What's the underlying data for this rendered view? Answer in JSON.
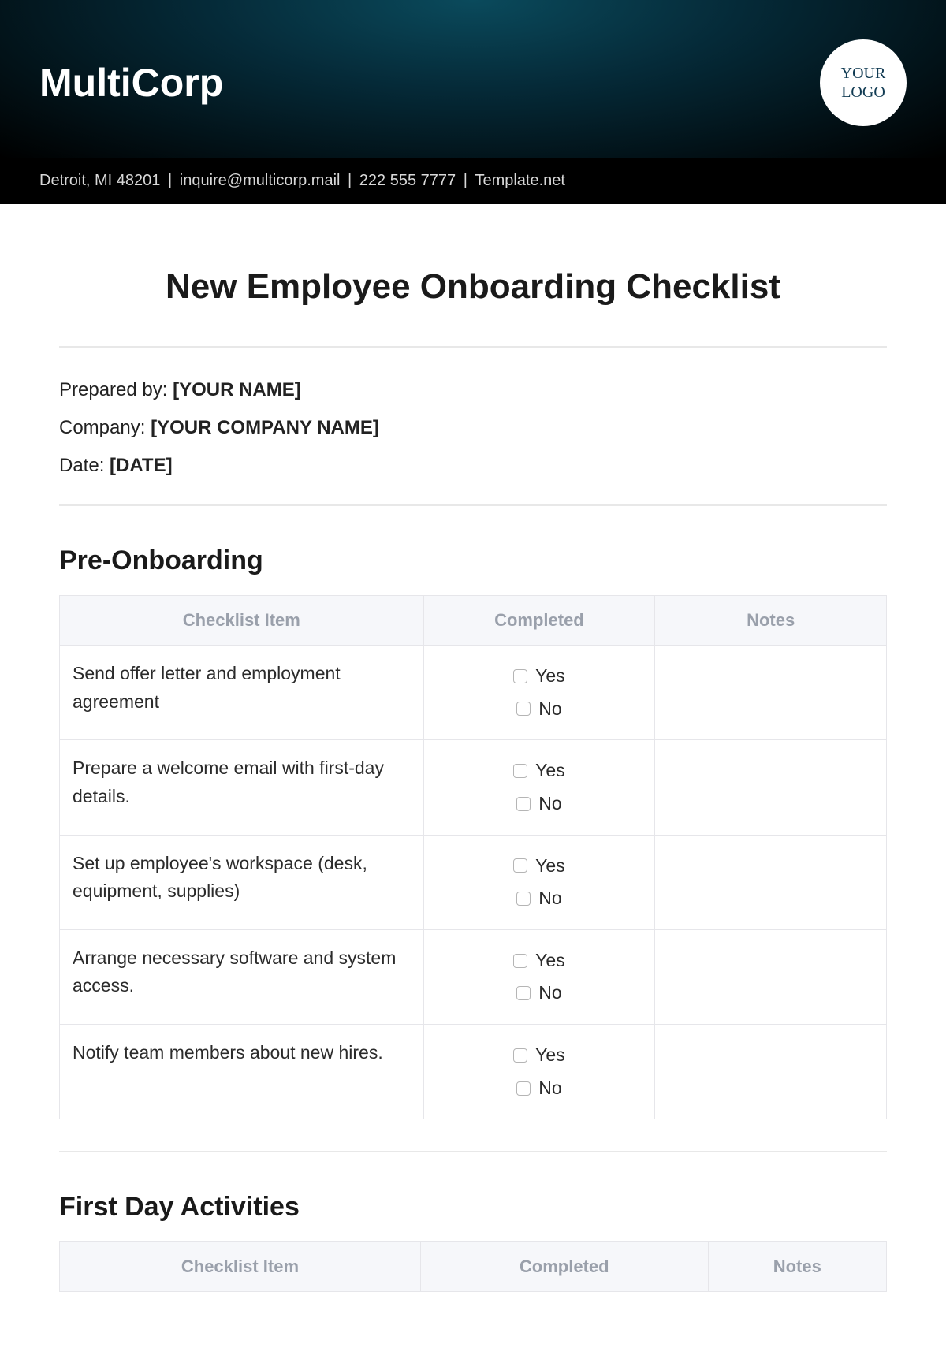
{
  "header": {
    "company_name": "MultiCorp",
    "logo_text": "YOUR\nLOGO"
  },
  "contact": {
    "address": "Detroit, MI 48201",
    "email": "inquire@multicorp.mail",
    "phone": "222 555 7777",
    "site": "Template.net"
  },
  "title": "New Employee Onboarding Checklist",
  "meta": {
    "prepared_by_label": "Prepared by: ",
    "prepared_by_value": "[YOUR NAME]",
    "company_label": "Company: ",
    "company_value": "[YOUR COMPANY NAME]",
    "date_label": "Date: ",
    "date_value": "[DATE]"
  },
  "columns": {
    "item": "Checklist Item",
    "completed": "Completed",
    "notes": "Notes"
  },
  "options": {
    "yes": "Yes",
    "no": "No"
  },
  "sections": [
    {
      "heading": "Pre-Onboarding",
      "items": [
        "Send offer letter and employment agreement",
        "Prepare a welcome email with first-day details.",
        "Set up employee's workspace (desk, equipment, supplies)",
        "Arrange necessary software and system access.",
        "Notify team members about new hires."
      ]
    },
    {
      "heading": "First Day Activities",
      "items": []
    }
  ]
}
